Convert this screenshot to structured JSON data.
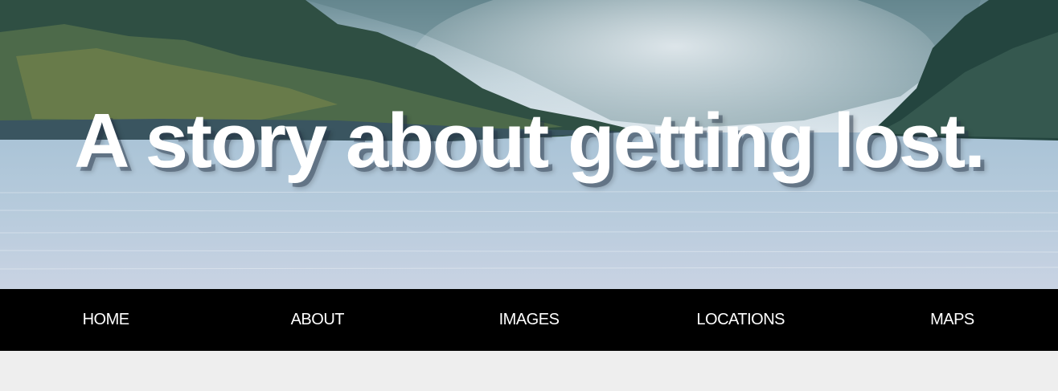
{
  "hero": {
    "title": "A story about getting lost."
  },
  "nav": {
    "items": [
      {
        "label": "HOME"
      },
      {
        "label": "ABOUT"
      },
      {
        "label": "IMAGES"
      },
      {
        "label": "LOCATIONS"
      },
      {
        "label": "MAPS"
      }
    ]
  },
  "colors": {
    "nav_background": "#000000",
    "nav_text": "#ffffff",
    "page_background": "#eeeeee",
    "title_text": "#ffffff"
  }
}
